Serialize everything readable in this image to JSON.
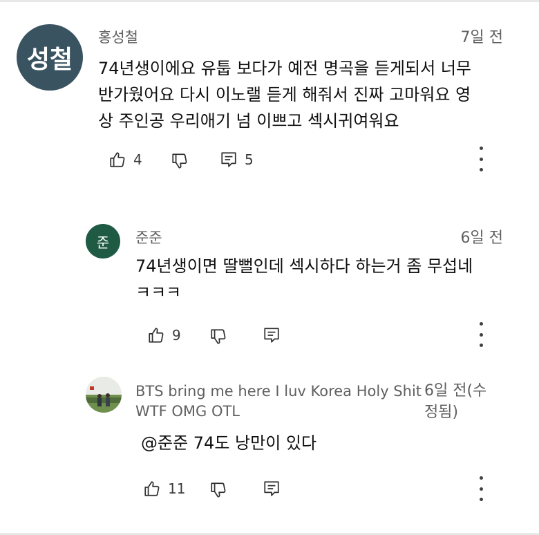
{
  "comments": [
    {
      "avatar_text": "성철",
      "avatar_color": "#3a5361",
      "author": "홍성철",
      "time": "7일 전",
      "text": "74년생이에요   유툽 보다가 예전 명곡을 듣게되서 너무\n반가웠어요  다시 이노랠 듣게 해줘서 진짜 고마워요  영\n상 주인공 우리애기  넘 이쁘고 섹시귀여워요",
      "likes": "4",
      "replies": "5"
    },
    {
      "avatar_text": "준",
      "avatar_color": "#1f5a45",
      "author": "준준",
      "time": "6일 전",
      "text": "74년생이면 딸뻘인데 섹시하다 하는거 좀 무섭네\nㅋㅋㅋ",
      "likes": "9"
    },
    {
      "author": "BTS bring me here I luv Korea Holy Shit\nWTF OMG OTL",
      "time": "6일 전(수\n정됨)",
      "text": "@준준  74도 낭만이 있다",
      "likes": "11"
    }
  ],
  "icons": {
    "like": "thumbs-up-icon",
    "dislike": "thumbs-down-icon",
    "reply": "reply-comment-icon",
    "more": "more-vertical-icon"
  }
}
